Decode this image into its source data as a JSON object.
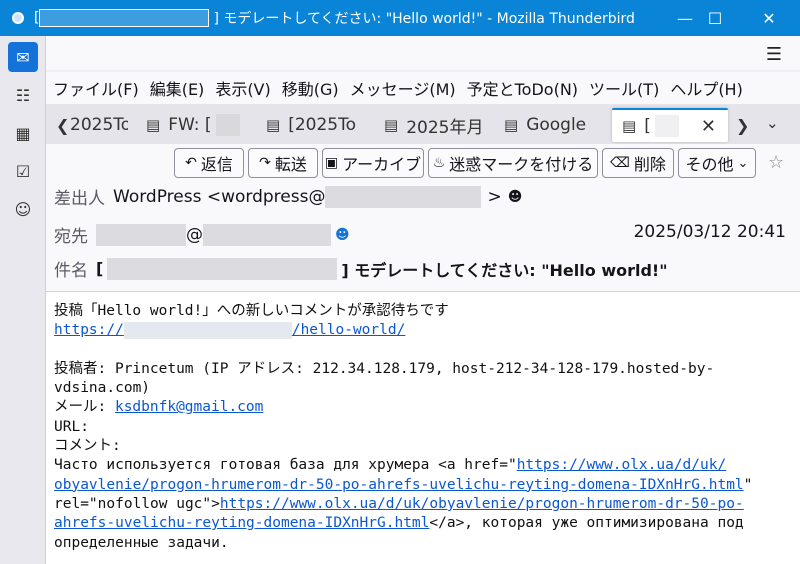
{
  "window": {
    "title_prefix": "[",
    "title_suffix": "] モデレートしてください: \"Hello world!\" - Mozilla Thunderbird",
    "minimize_icon": "minimize-icon",
    "maximize_icon": "maximize-icon",
    "close_icon": "close-icon"
  },
  "menu": [
    "ファイル(F)",
    "編集(E)",
    "表示(V)",
    "移動(G)",
    "メッセージ(M)",
    "予定とToDo(N)",
    "ツール(T)",
    "ヘルプ(H)"
  ],
  "tabs": {
    "t1": "2025To",
    "t2": "FW: [",
    "t3": "[2025To",
    "t4": "2025年月",
    "t5": "Google",
    "t6": "["
  },
  "toolbar": {
    "reply": "返信",
    "forward": "転送",
    "archive": "アーカイブ",
    "junk": "迷惑マークを付ける",
    "delete": "削除",
    "other": "その他"
  },
  "header": {
    "from_label": "差出人",
    "from_name": "WordPress <wordpress@",
    "from_end": ">",
    "to_label": "宛先",
    "to_at": "@",
    "date": "2025/03/12 20:41",
    "subject_label": "件名",
    "subject_prefix": "[",
    "subject_suffix": "] モデレートしてください: \"Hello world!\""
  },
  "body": {
    "l1": "投稿「Hello world!」への新しいコメントが承認待ちです",
    "url_prefix": "https://",
    "url_suffix": "/hello-world/",
    "l3": "投稿者: Princetum (IP アドレス: 212.34.128.179, host-212-34-128-179.hosted-by-",
    "l4": "vdsina.com)",
    "mail_label": "メール: ",
    "mail": "ksdbnfk@gmail.com",
    "url_label": "URL:",
    "comment_label": "コメント:",
    "c1": "Часто используется готовая база для хрумера <a href=\"",
    "c1_link": "https://www.olx.ua/d/uk/",
    "c2_link": "obyavlenie/progon-hrumerom-dr-50-po-ahrefs-uvelichu-reyting-domena-IDXnHrG.html",
    "c2_end": "\"",
    "c3": "rel=\"nofollow ugc\">",
    "c3_link": "https://www.olx.ua/d/uk/obyavlenie/progon-hrumerom-dr-50-po-",
    "c4_link": "ahrefs-uvelichu-reyting-domena-IDXnHrG.html",
    "c4": "</a>, которая уже оптимизирована под",
    "c5": "определенные задачи."
  }
}
